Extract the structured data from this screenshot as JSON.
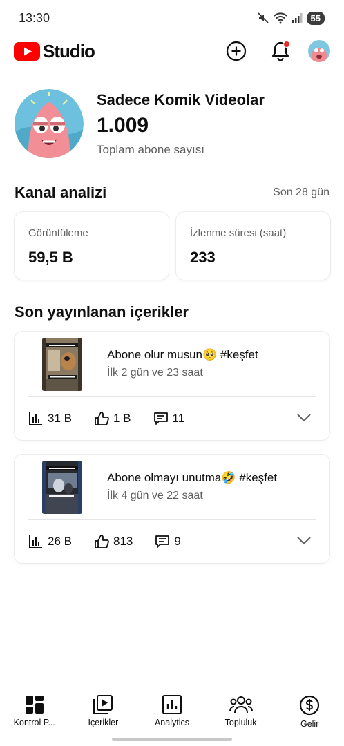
{
  "status_bar": {
    "time": "13:30",
    "battery": "55",
    "icons": [
      "mute-icon",
      "wifi-icon",
      "signal-icon"
    ]
  },
  "header": {
    "brand": "Studio",
    "brand_color": "#ff0000",
    "actions": [
      "create-icon",
      "notifications-icon",
      "account-avatar"
    ],
    "notification_dot_color": "#e52d27"
  },
  "channel": {
    "name": "Sadece Komik Videolar",
    "subscriber_count": "1.009",
    "subscriber_label": "Toplam abone sayısı"
  },
  "analytics": {
    "title": "Kanal analizi",
    "period": "Son 28 gün",
    "cards": [
      {
        "label": "Görüntüleme",
        "value": "59,5 B"
      },
      {
        "label": "İzlenme süresi (saat)",
        "value": "233"
      }
    ]
  },
  "recent": {
    "title": "Son yayınlanan içerikler",
    "videos": [
      {
        "title": "Abone olur musun🥺 #keşfet",
        "subtitle": "İlk 2 gün ve 23 saat",
        "views": "31 B",
        "likes": "1 B",
        "comments": "11"
      },
      {
        "title": "Abone olmayı unutma🤣 #keşfet",
        "subtitle": "İlk 4 gün ve 22 saat",
        "views": "26 B",
        "likes": "813",
        "comments": "9"
      }
    ]
  },
  "bottom_nav": [
    {
      "label": "Kontrol P...",
      "icon": "dashboard-icon"
    },
    {
      "label": "İçerikler",
      "icon": "content-icon"
    },
    {
      "label": "Analytics",
      "icon": "analytics-icon"
    },
    {
      "label": "Topluluk",
      "icon": "community-icon"
    },
    {
      "label": "Gelir",
      "icon": "earn-icon"
    }
  ]
}
